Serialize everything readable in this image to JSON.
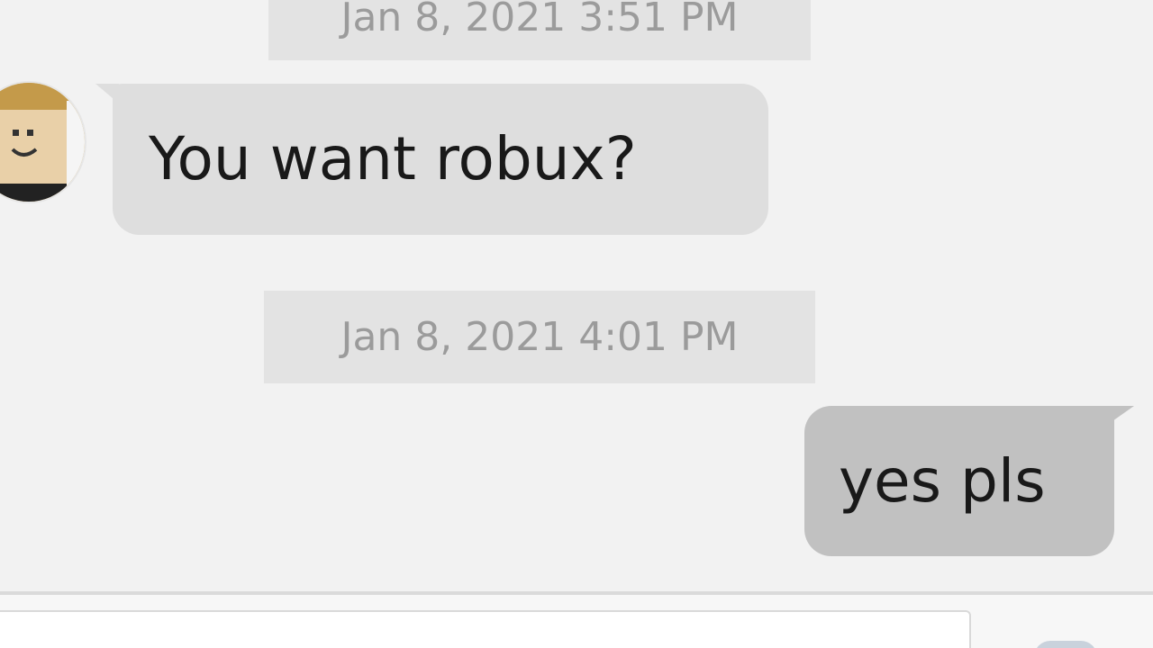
{
  "conversation": {
    "messages": [
      {
        "timestamp": "Jan 8, 2021 3:51 PM",
        "direction": "incoming",
        "text": "You want robux?"
      },
      {
        "timestamp": "Jan 8, 2021 4:01 PM",
        "direction": "outgoing",
        "text": "yes pls"
      }
    ]
  },
  "composer": {
    "value": "",
    "send_icon": "send-icon"
  },
  "colors": {
    "background": "#f2f2f2",
    "incoming_bubble": "#dedede",
    "outgoing_bubble": "#c1c1c1",
    "timestamp_bg": "#e3e3e3",
    "timestamp_text": "#9b9b9b"
  }
}
